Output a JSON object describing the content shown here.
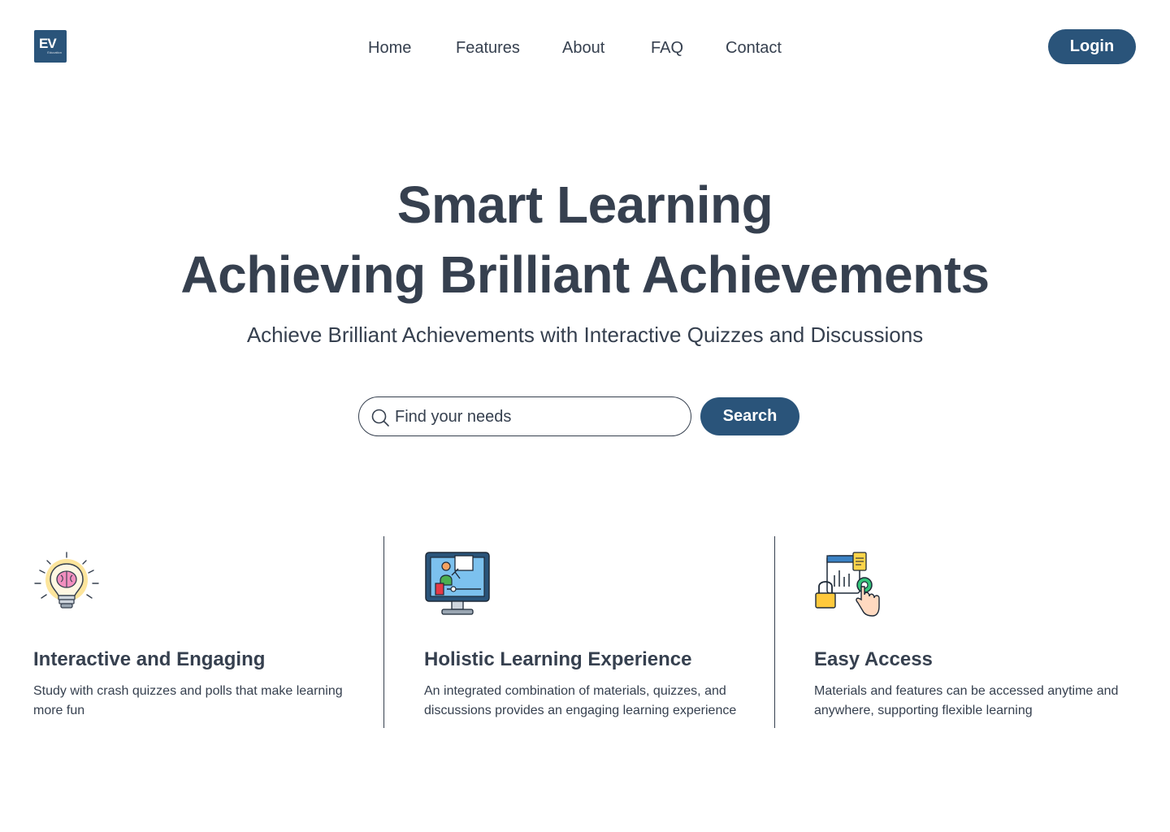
{
  "logo": {
    "text": "EV",
    "tagline": "Education"
  },
  "nav": {
    "items": [
      {
        "label": "Home"
      },
      {
        "label": "Features"
      },
      {
        "label": "About"
      },
      {
        "label": "FAQ"
      },
      {
        "label": "Contact"
      }
    ],
    "login_label": "Login"
  },
  "hero": {
    "title_line1": "Smart Learning",
    "title_line2": "Achieving Brilliant Achievements",
    "subtitle": "Achieve Brilliant Achievements with Interactive Quizzes and Discussions"
  },
  "search": {
    "placeholder": "Find your needs",
    "button_label": "Search",
    "icon": "search-icon"
  },
  "features": [
    {
      "icon": "lightbulb-brain-icon",
      "title": "Interactive and Engaging",
      "description": "Study with crash quizzes and polls that make learning more fun"
    },
    {
      "icon": "monitor-teacher-icon",
      "title": "Holistic Learning Experience",
      "description": "An integrated combination of materials, quizzes, and discussions provides an engaging learning experience"
    },
    {
      "icon": "access-touch-icon",
      "title": "Easy Access",
      "description": "Materials and features can be accessed anytime and anywhere, supporting flexible learning"
    }
  ],
  "colors": {
    "primary": "#2a547a",
    "text": "#36404f",
    "background": "#ffffff"
  }
}
